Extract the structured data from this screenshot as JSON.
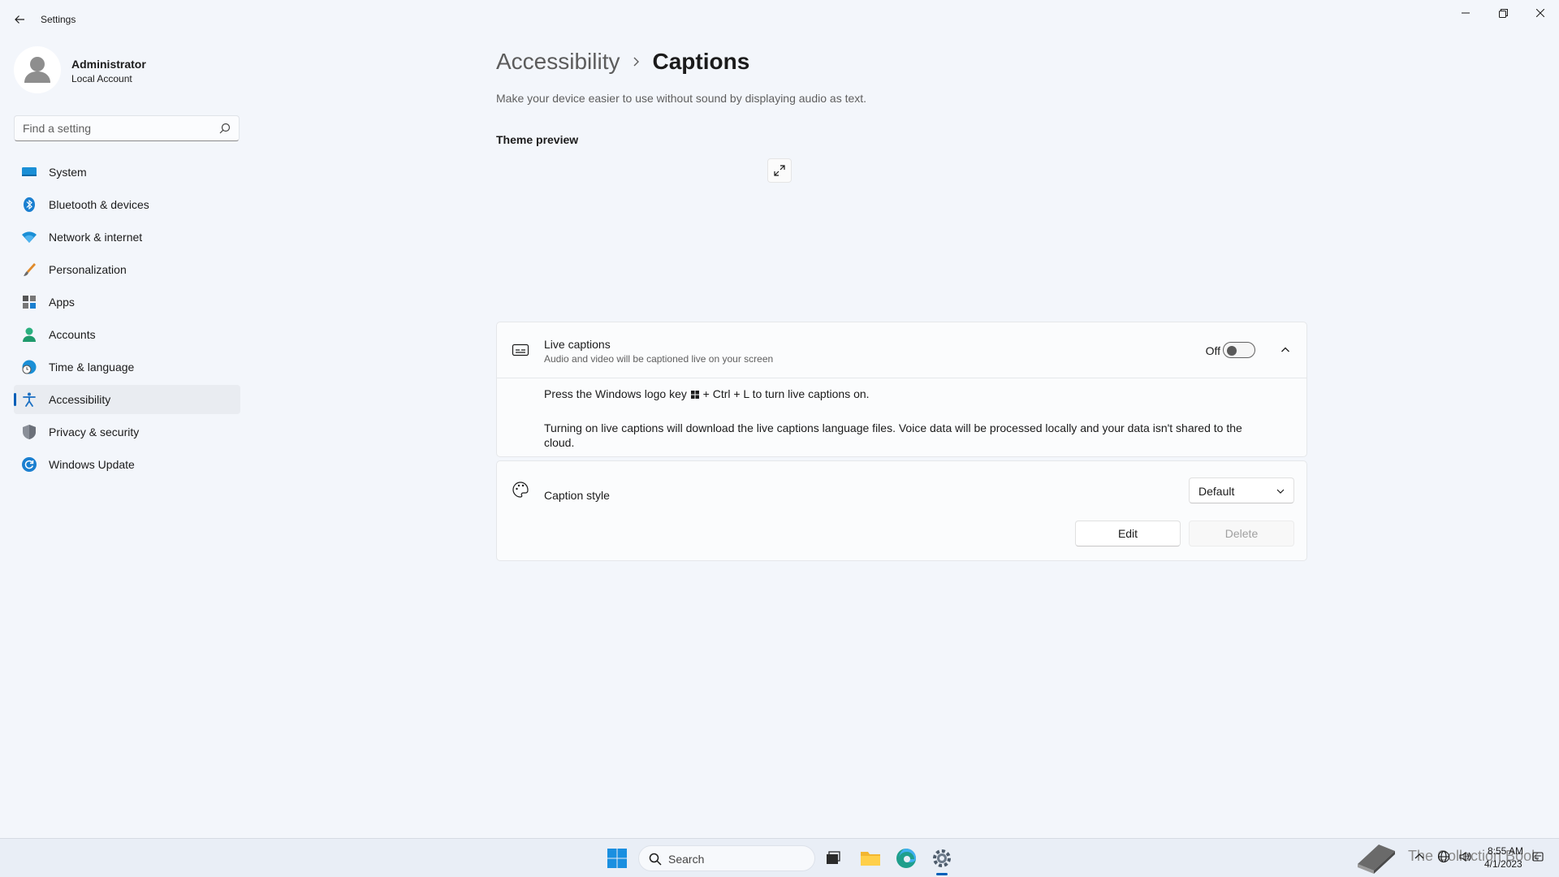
{
  "window": {
    "title": "Settings",
    "controls": {
      "minimize": "minimize-icon",
      "maximize": "restore-icon",
      "close": "close-icon"
    }
  },
  "profile": {
    "name": "Administrator",
    "account_type": "Local Account"
  },
  "search": {
    "placeholder": "Find a setting"
  },
  "sidebar": {
    "items": [
      {
        "label": "System",
        "icon": "system-icon",
        "active": false
      },
      {
        "label": "Bluetooth & devices",
        "icon": "bluetooth-icon",
        "active": false
      },
      {
        "label": "Network & internet",
        "icon": "network-icon",
        "active": false
      },
      {
        "label": "Personalization",
        "icon": "brush-icon",
        "active": false
      },
      {
        "label": "Apps",
        "icon": "apps-icon",
        "active": false
      },
      {
        "label": "Accounts",
        "icon": "accounts-icon",
        "active": false
      },
      {
        "label": "Time & language",
        "icon": "time-language-icon",
        "active": false
      },
      {
        "label": "Accessibility",
        "icon": "accessibility-icon",
        "active": true
      },
      {
        "label": "Privacy & security",
        "icon": "shield-icon",
        "active": false
      },
      {
        "label": "Windows Update",
        "icon": "windows-update-icon",
        "active": false
      }
    ]
  },
  "main": {
    "breadcrumb": {
      "parent": "Accessibility",
      "current": "Captions"
    },
    "description": "Make your device easier to use without sound by displaying audio as text.",
    "theme_preview_title": "Theme preview",
    "live_captions": {
      "title": "Live captions",
      "subtitle": "Audio and video will be captioned live on your screen",
      "toggle_state": "Off",
      "shortcut_before": "Press the Windows logo key",
      "shortcut_after": "+ Ctrl + L to turn live captions on.",
      "download_note": "Turning on live captions will download the live captions language files. Voice data will be processed locally and your data isn't shared to the cloud."
    },
    "caption_style": {
      "title": "Caption style",
      "selected": "Default",
      "edit_label": "Edit",
      "delete_label": "Delete"
    }
  },
  "taskbar": {
    "search_label": "Search",
    "watermark": "The Collection Book",
    "time": "8:55 AM",
    "date": "4/1/2023"
  },
  "colors": {
    "accent": "#005fb8",
    "background": "#f3f6fb",
    "card": "#fbfcfd"
  }
}
